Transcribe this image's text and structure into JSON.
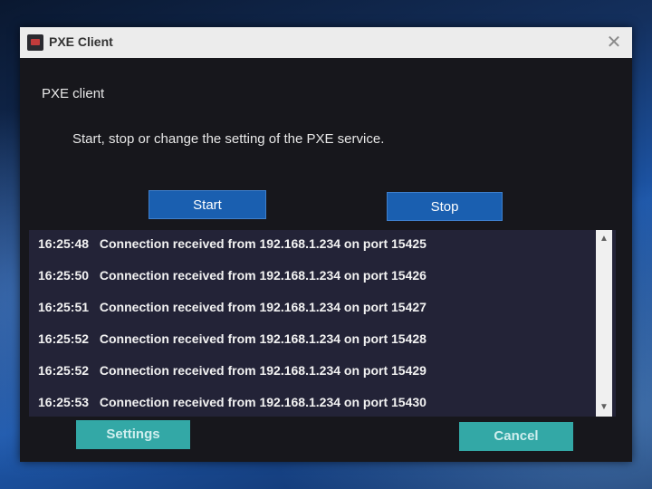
{
  "window": {
    "title": "PXE Client",
    "close_glyph": "✕"
  },
  "main": {
    "heading": "PXE client",
    "description": "Start, stop or change the setting of the PXE service."
  },
  "buttons": {
    "start_label": "Start",
    "stop_label": "Stop",
    "settings_label": "Settings",
    "cancel_label": "Cancel"
  },
  "log": [
    {
      "time": "16:25:48",
      "message": "Connection received from 192.168.1.234 on port 15425"
    },
    {
      "time": "16:25:50",
      "message": "Connection received from 192.168.1.234 on port 15426"
    },
    {
      "time": "16:25:51",
      "message": "Connection received from 192.168.1.234 on port 15427"
    },
    {
      "time": "16:25:52",
      "message": "Connection received from 192.168.1.234 on port 15428"
    },
    {
      "time": "16:25:52",
      "message": "Connection received from 192.168.1.234 on port 15429"
    },
    {
      "time": "16:25:53",
      "message": "Connection received from 192.168.1.234 on port 15430"
    }
  ],
  "scrollbar": {
    "up_glyph": "▲",
    "down_glyph": "▼"
  },
  "colors": {
    "primary_button": "#1a5fb0",
    "secondary_button": "#33a8a6",
    "window_background": "#17171c",
    "log_background": "#232337"
  }
}
